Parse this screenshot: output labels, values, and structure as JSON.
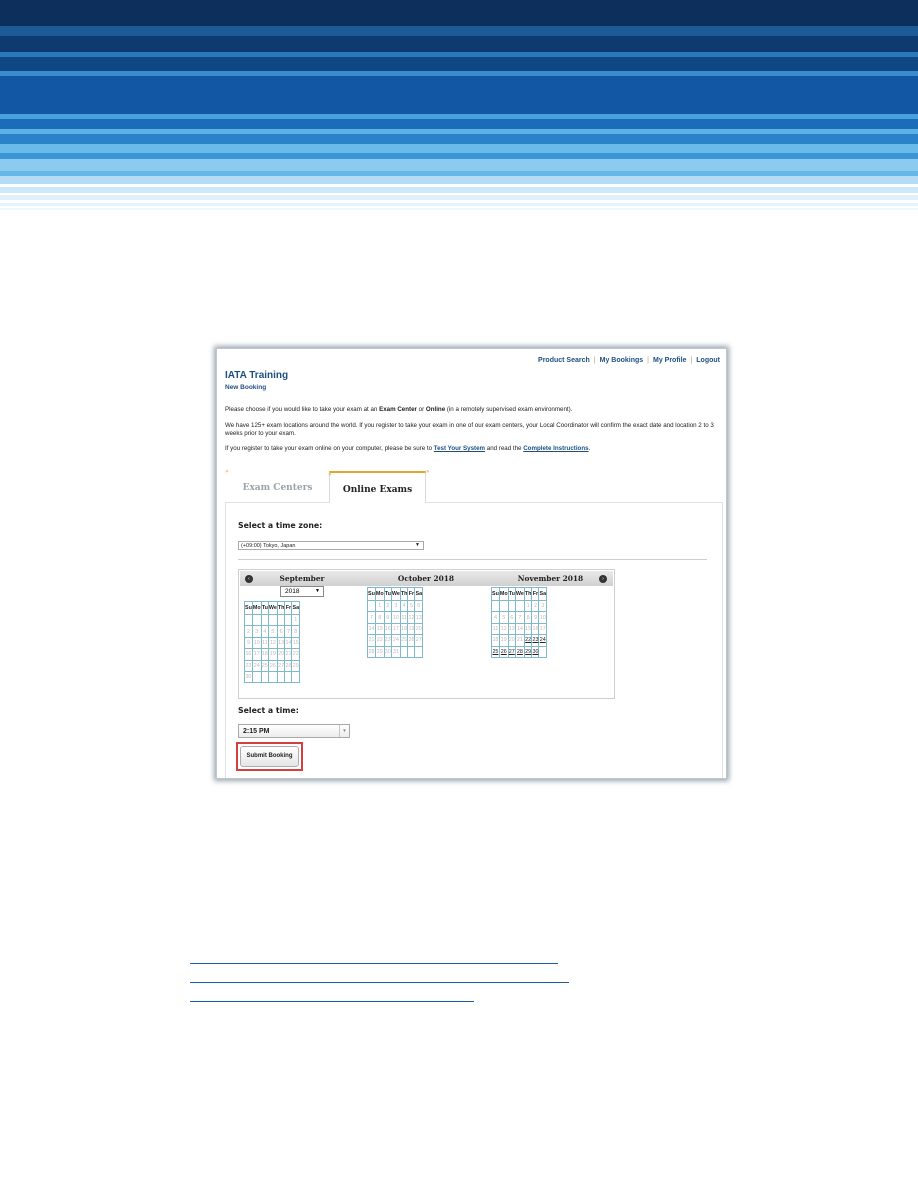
{
  "colors": {
    "brand_blue": "#1e4f82",
    "tab_accent": "#e4a52b",
    "highlight_red": "#d43f3f"
  },
  "topnav": [
    "Product Search",
    "My Bookings",
    "My Profile",
    "Logout"
  ],
  "brand": {
    "title": "IATA  Training",
    "subtitle": "New Booking"
  },
  "intro": {
    "p1_a": "Please choose if you would like to take your exam at an ",
    "p1_b": "Exam Center",
    "p1_c": " or ",
    "p1_d": "Online",
    "p1_e": " (in a remotely supervised exam environment).",
    "p2": "We have 125+ exam locations around the world. If you register to take your exam in one of our exam centers, your Local Coordinator will confirm the exact date and location 2 to 3 weeks prior to your exam.",
    "p3_a": "If you register to take your exam online on your computer, please be sure to ",
    "p3_link1": "Test Your System",
    "p3_b": " and read the ",
    "p3_link2": "Complete Instructions",
    "p3_c": "."
  },
  "tabs": {
    "exam_centers": "Exam Centers",
    "online_exams": "Online Exams",
    "mark": "»"
  },
  "timezone": {
    "label": "Select a time zone:",
    "value": "(+09:00) Tokyo, Japan"
  },
  "calendar": {
    "prev_icon": "‹",
    "next_icon": "›",
    "weekdays": [
      "Su",
      "Mo",
      "Tu",
      "We",
      "Th",
      "Fr",
      "Sa"
    ],
    "months": [
      {
        "name": "September",
        "year_select": "2018",
        "weeks": [
          [
            "",
            "",
            "",
            "",
            "",
            "",
            "1"
          ],
          [
            "2",
            "3",
            "4",
            "5",
            "6",
            "7",
            "8"
          ],
          [
            "9",
            "10",
            "11",
            "12",
            "13",
            "14",
            "15"
          ],
          [
            "16",
            "17",
            "18",
            "19",
            "20",
            "21",
            "22"
          ],
          [
            "23",
            "24",
            "25",
            "26",
            "27",
            "28",
            "29"
          ],
          [
            "30",
            "",
            "",
            "",
            "",
            "",
            ""
          ]
        ],
        "available": []
      },
      {
        "name": "October 2018",
        "weeks": [
          [
            "",
            "1",
            "2",
            "3",
            "4",
            "5",
            "6"
          ],
          [
            "7",
            "8",
            "9",
            "10",
            "11",
            "12",
            "13"
          ],
          [
            "14",
            "15",
            "16",
            "17",
            "18",
            "19",
            "20"
          ],
          [
            "21",
            "22",
            "23",
            "24",
            "25",
            "26",
            "27"
          ],
          [
            "28",
            "29",
            "30",
            "31",
            "",
            "",
            ""
          ]
        ],
        "available": []
      },
      {
        "name": "November 2018",
        "weeks": [
          [
            "",
            "",
            "",
            "",
            "1",
            "2",
            "3"
          ],
          [
            "4",
            "5",
            "6",
            "7",
            "8",
            "9",
            "10"
          ],
          [
            "11",
            "12",
            "13",
            "14",
            "15",
            "16",
            "17"
          ],
          [
            "18",
            "19",
            "20",
            "21",
            "22",
            "23",
            "24"
          ],
          [
            "25",
            "26",
            "27",
            "28",
            "29",
            "30",
            ""
          ]
        ],
        "available": [
          "22",
          "23",
          "24",
          "25",
          "26",
          "27",
          "28",
          "29",
          "30"
        ]
      }
    ]
  },
  "time": {
    "label": "Select a time:",
    "value": "2:15 PM"
  },
  "submit_label": "Submit Booking"
}
